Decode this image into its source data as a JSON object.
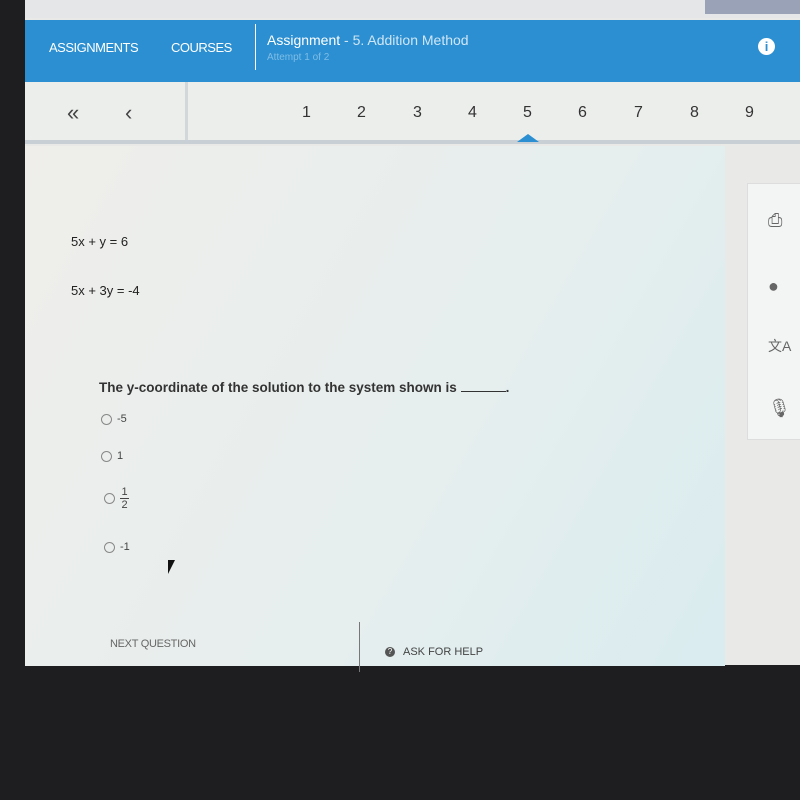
{
  "header": {
    "nav": [
      "ASSIGNMENTS",
      "COURSES"
    ],
    "title": "Assignment",
    "subtitle": " - 5. Addition Method",
    "attempt": "Attempt 1 of 2",
    "info_icon": "info-icon"
  },
  "pager": {
    "first": "«",
    "prev": "‹",
    "pages": [
      "1",
      "2",
      "3",
      "4",
      "5",
      "6",
      "7",
      "8",
      "9"
    ],
    "current": "5"
  },
  "question": {
    "equations": [
      "5x + y = 6",
      "5x + 3y = -4"
    ],
    "prompt": "The y-coordinate of the solution to the system shown is",
    "prompt_end": ".",
    "options": [
      "-5",
      "1",
      {
        "num": "1",
        "den": "2"
      },
      "-1"
    ]
  },
  "tools": [
    "print-icon",
    "globe-icon",
    "translate-icon",
    "microphone-icon"
  ],
  "footer": {
    "next": "NEXT QUESTION",
    "help": "ASK FOR HELP"
  },
  "colors": {
    "accent": "#2b8fd1"
  }
}
